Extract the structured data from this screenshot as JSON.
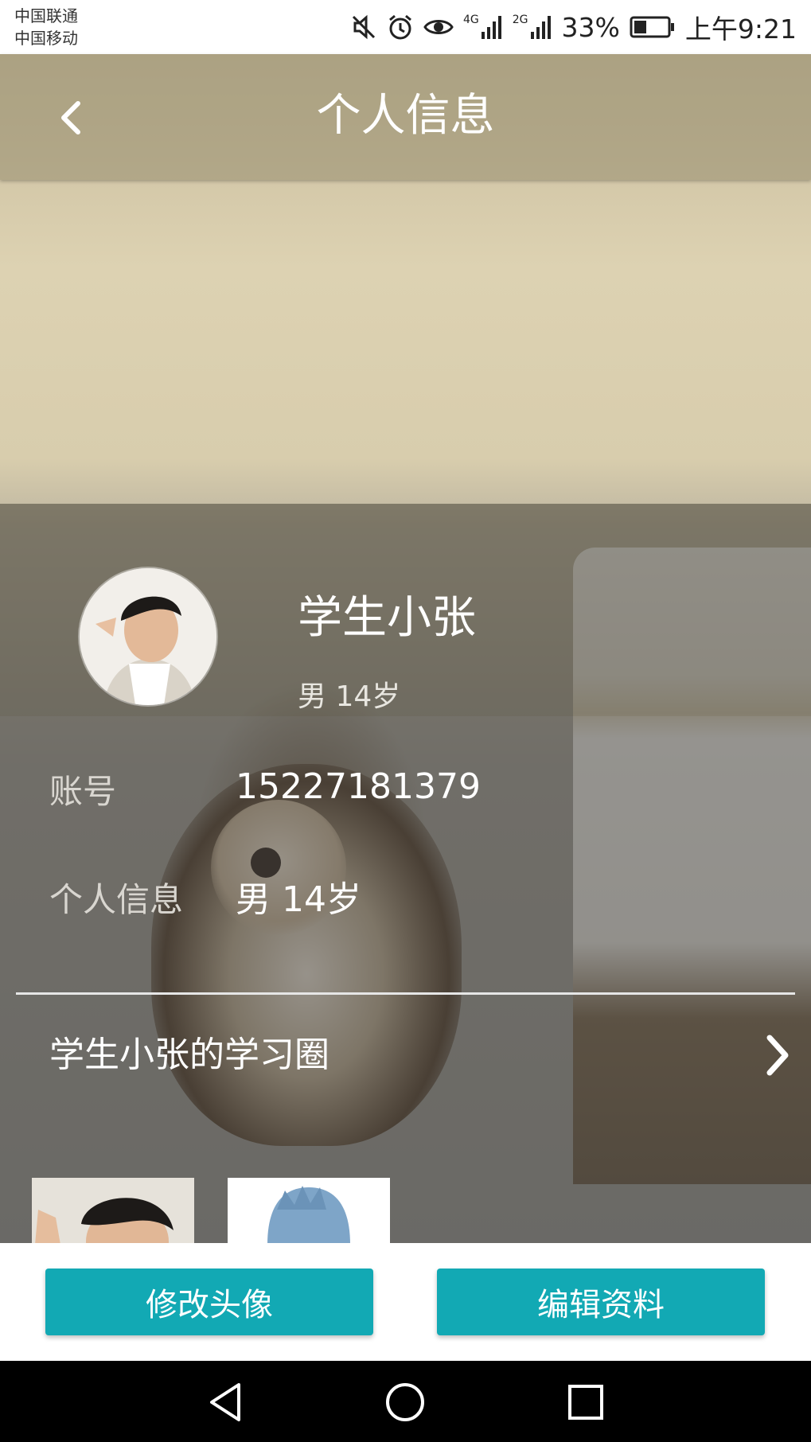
{
  "status_bar": {
    "carrier_1": "中国联通",
    "carrier_2": "中国移动",
    "net_1": "4G",
    "net_2": "2G",
    "battery": "33%",
    "time": "上午9:21",
    "icons": [
      "mute-icon",
      "alarm-icon",
      "eye-icon",
      "signal-icon",
      "signal-icon",
      "battery-icon"
    ]
  },
  "header": {
    "title": "个人信息",
    "back_icon": "chevron-left-icon"
  },
  "profile": {
    "name": "学生小张",
    "gender_age": "男 14岁"
  },
  "info": {
    "account_label": "账号",
    "account_value": "15227181379",
    "personal_label": "个人信息",
    "personal_value": "男 14岁"
  },
  "study_circle": {
    "title": "学生小张的学习圈",
    "chevron_icon": "chevron-right-icon"
  },
  "actions": {
    "change_avatar": "修改头像",
    "edit_profile": "编辑资料"
  },
  "nav": {
    "back": "triangle-back-icon",
    "home": "circle-home-icon",
    "recents": "square-recents-icon"
  },
  "colors": {
    "accent": "#12a9b4",
    "header_overlay": "#968c6e",
    "white": "#ffffff"
  }
}
